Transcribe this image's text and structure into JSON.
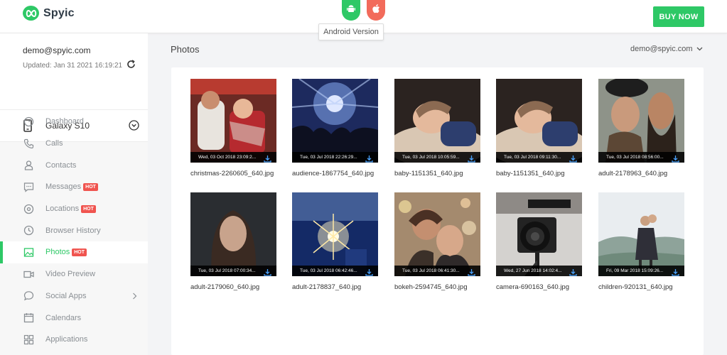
{
  "header": {
    "brand": "Spyic",
    "platform_tooltip": "Android Version",
    "buy_button": "BUY NOW",
    "colors": {
      "accent": "#2ec866",
      "apple": "#f26b5b",
      "badge": "#f0544f"
    },
    "icons": [
      "spyic-logo-icon",
      "android-icon",
      "apple-icon"
    ]
  },
  "account": {
    "email": "demo@spyic.com",
    "updated": "Updated: Jan 31 2021 16:19:21"
  },
  "device": {
    "name": "Galaxy S10"
  },
  "nav": [
    {
      "label": "Dashboard",
      "icon": "dashboard-icon"
    },
    {
      "label": "Calls",
      "icon": "phone-icon"
    },
    {
      "label": "Contacts",
      "icon": "contact-icon"
    },
    {
      "label": "Messages",
      "icon": "message-icon",
      "badge": "HOT"
    },
    {
      "label": "Locations",
      "icon": "location-icon",
      "badge": "HOT"
    },
    {
      "label": "Browser History",
      "icon": "clock-icon"
    },
    {
      "label": "Photos",
      "icon": "image-icon",
      "badge": "HOT",
      "active": true
    },
    {
      "label": "Video Preview",
      "icon": "video-icon"
    },
    {
      "label": "Social Apps",
      "icon": "chat-icon",
      "has_submenu": true
    },
    {
      "label": "Calendars",
      "icon": "calendar-icon"
    },
    {
      "label": "Applications",
      "icon": "apps-icon"
    }
  ],
  "main": {
    "title": "Photos",
    "user_email": "demo@spyic.com"
  },
  "photos": [
    {
      "name": "christmas-2260605_640.jpg",
      "date": "Wed, 03 Oct 2018 23:09:2..."
    },
    {
      "name": "audience-1867754_640.jpg",
      "date": "Tue, 03 Jul 2018 22:26:29..."
    },
    {
      "name": "baby-1151351_640.jpg",
      "date": "Tue, 03 Jul 2018 10:05:59..."
    },
    {
      "name": "baby-1151351_640.jpg",
      "date": "Tue, 03 Jul 2018 09:11:30..."
    },
    {
      "name": "adult-2178963_640.jpg",
      "date": "Tue, 03 Jul 2018 08:56:00..."
    },
    {
      "name": "adult-2179060_640.jpg",
      "date": "Tue, 03 Jul 2018 07:00:34..."
    },
    {
      "name": "adult-2178837_640.jpg",
      "date": "Tue, 03 Jul 2018 06:42:46..."
    },
    {
      "name": "bokeh-2594745_640.jpg",
      "date": "Tue, 03 Jul 2018 06:41:30..."
    },
    {
      "name": "camera-690163_640.jpg",
      "date": "Wed, 27 Jun 2018 14:02:4..."
    },
    {
      "name": "children-920131_640.jpg",
      "date": "Fri, 09 Mar 2018 15:09:26..."
    }
  ]
}
